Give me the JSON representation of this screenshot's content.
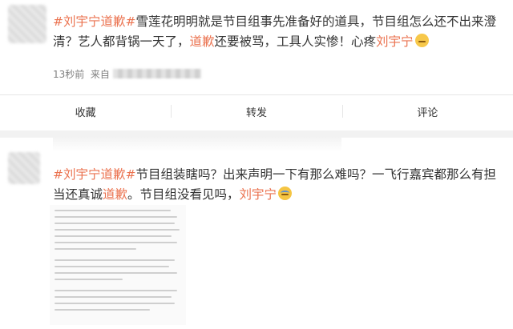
{
  "post1": {
    "hashtag": "#刘宇宁道歉#",
    "body_a": "雪莲花明明就是节目组事先准备好的道具，节目组怎么还不出来澄清？艺人都背锅一天了，",
    "hl_a": "道歉",
    "body_b": "还要被骂，工具人实惨！心疼",
    "hl_b": "刘宇宁",
    "emoji": "sad-face",
    "meta_time": "13秒前",
    "meta_from": "来自",
    "actions": {
      "collect": "收藏",
      "repost": "转发",
      "comment": "评论"
    }
  },
  "post2": {
    "hashtag": "#刘宇宁道歉#",
    "body_a": "节目组装瞎吗？出来声明一下有那么难吗？一飞行嘉宾都那么有担当还真诚",
    "hl_a": "道歉",
    "body_b": "。节目组没看见吗，",
    "hl_b": "刘宇宁",
    "emoji": "crying-face"
  }
}
